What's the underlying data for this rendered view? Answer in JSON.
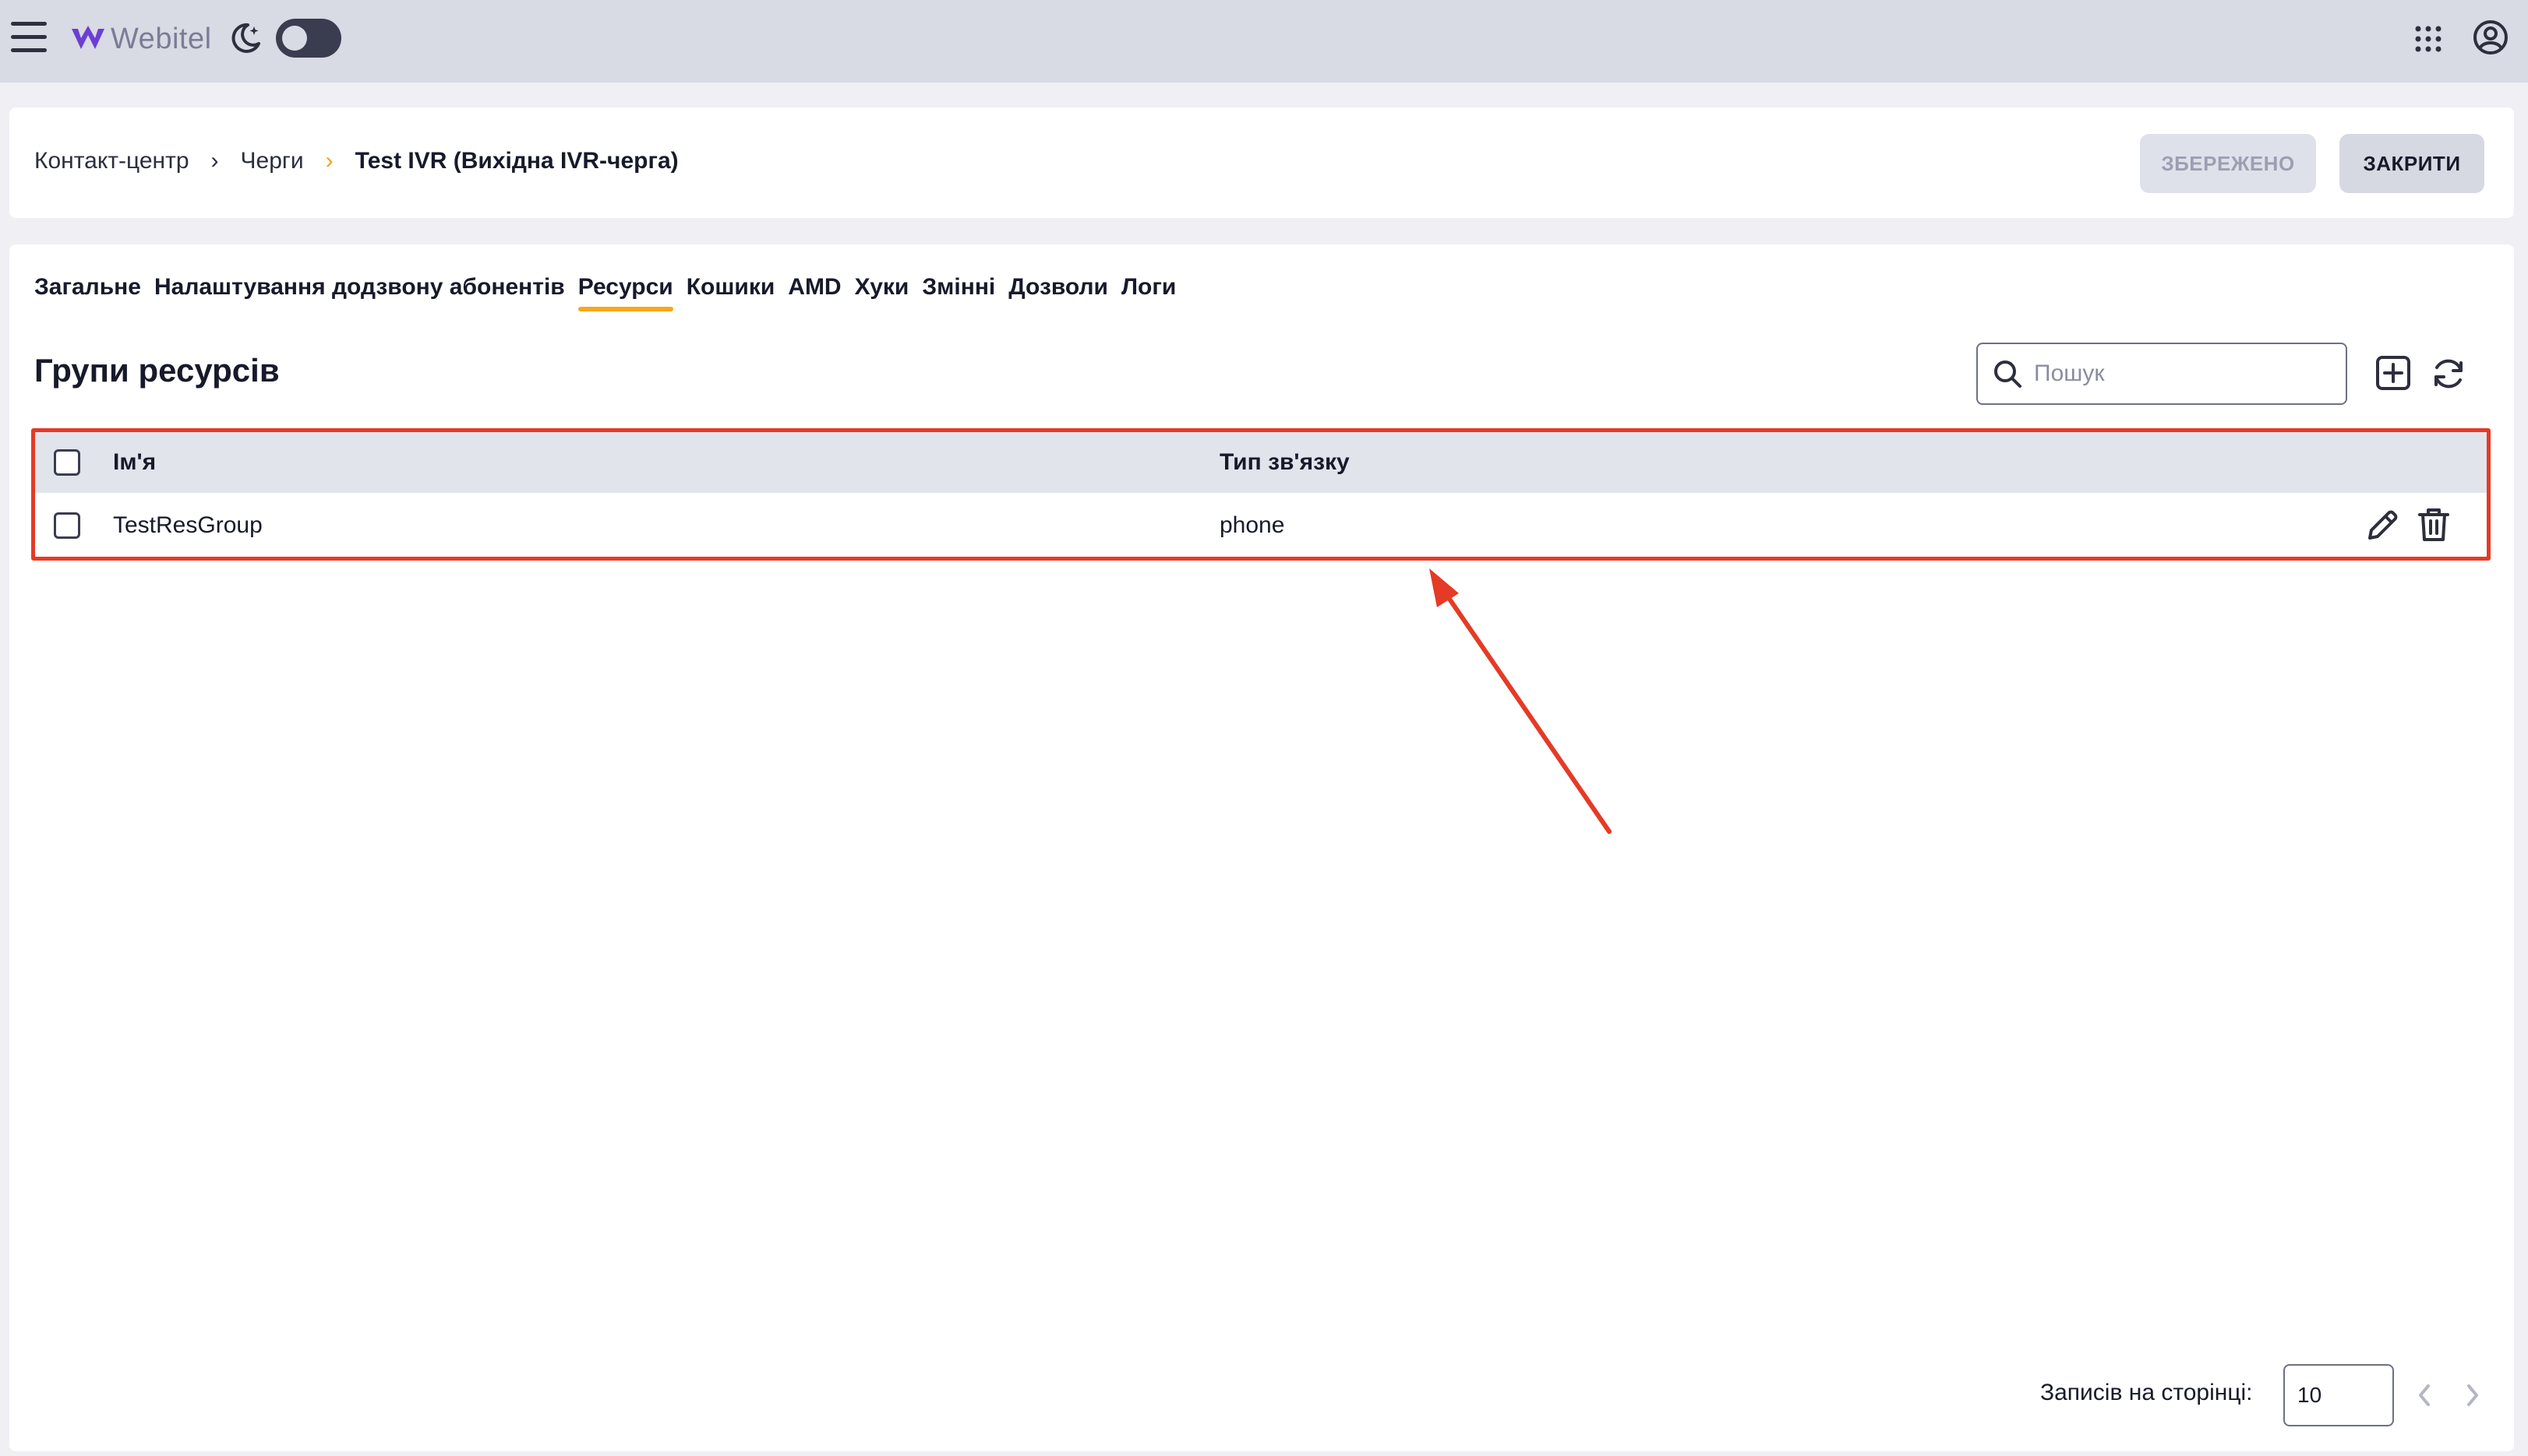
{
  "topbar": {
    "logo_text": "Webitel",
    "icons": [
      "menu-icon",
      "webitel-logo",
      "moon-icon",
      "theme-toggle",
      "apps-grid-icon",
      "account-icon"
    ],
    "theme_toggle_on": false
  },
  "header": {
    "breadcrumbs": [
      "Контакт-центр",
      "Черги",
      "Test IVR (Вихідна IVR-черга)"
    ],
    "saved_label": "ЗБЕРЕЖЕНО",
    "close_label": "ЗАКРИТИ"
  },
  "tabs": [
    {
      "label": "Загальне",
      "active": false
    },
    {
      "label": "Налаштування додзвону абонентів",
      "active": false
    },
    {
      "label": "Ресурси",
      "active": true
    },
    {
      "label": "Кошики",
      "active": false
    },
    {
      "label": "AMD",
      "active": false
    },
    {
      "label": "Хуки",
      "active": false
    },
    {
      "label": "Змінні",
      "active": false
    },
    {
      "label": "Дозволи",
      "active": false
    },
    {
      "label": "Логи",
      "active": false
    }
  ],
  "section": {
    "title": "Групи ресурсів",
    "search_placeholder": "Пошук"
  },
  "table": {
    "headers": [
      "Ім'я",
      "Тип зв'язку"
    ],
    "rows": [
      {
        "name": "TestResGroup",
        "type": "phone"
      }
    ]
  },
  "pagination": {
    "per_page_label": "Записів на сторінці:",
    "per_page_value": "10"
  },
  "colors": {
    "topbar_bg": "#d8dae4",
    "accent_tab": "#f6a81c",
    "annotation": "#e53a26"
  }
}
